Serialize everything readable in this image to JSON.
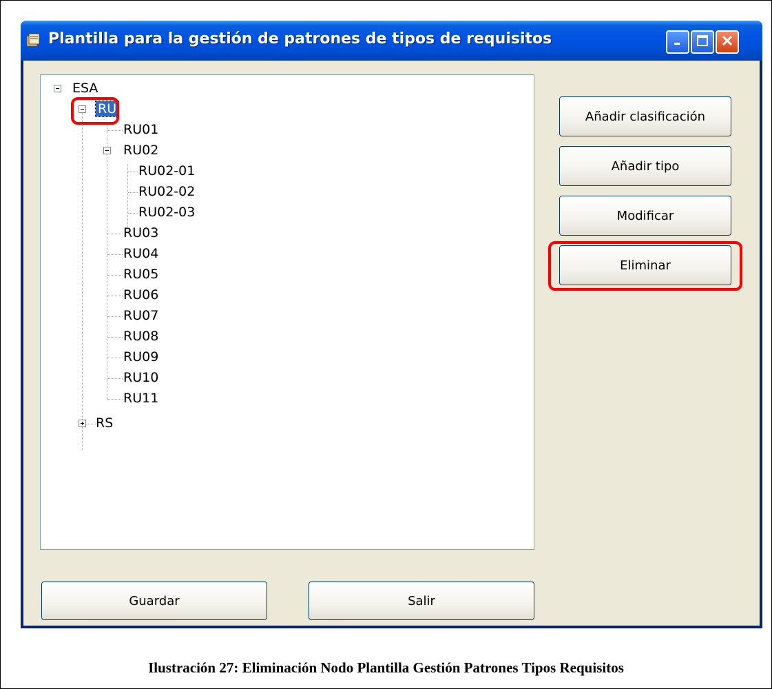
{
  "window": {
    "title": "Plantilla para la gestión de patrones de tipos de requisitos"
  },
  "tree": {
    "root": "ESA",
    "ru": "RU",
    "ru01": "RU01",
    "ru02": "RU02",
    "ru02_01": "RU02-01",
    "ru02_02": "RU02-02",
    "ru02_03": "RU02-03",
    "ru03": "RU03",
    "ru04": "RU04",
    "ru05": "RU05",
    "ru06": "RU06",
    "ru07": "RU07",
    "ru08": "RU08",
    "ru09": "RU09",
    "ru10": "RU10",
    "ru11": "RU11",
    "rs": "RS",
    "selected": "RU"
  },
  "buttons": {
    "add_classification": "Añadir clasificación",
    "add_type": "Añadir tipo",
    "modify": "Modificar",
    "delete": "Eliminar",
    "save": "Guardar",
    "exit": "Salir"
  },
  "caption": "Ilustración 27: Eliminación Nodo Plantilla Gestión Patrones Tipos Requisitos",
  "colors": {
    "titlebar": "#0054e3",
    "selection": "#316ac5",
    "highlight": "#ff0000",
    "client_bg": "#ece9d8"
  }
}
